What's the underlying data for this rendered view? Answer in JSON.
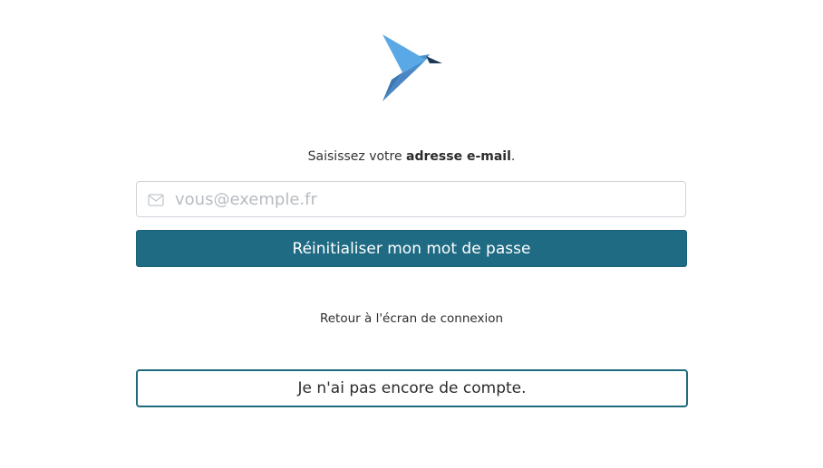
{
  "instruction": {
    "prefix": "Saisissez votre ",
    "emphasis": "adresse e-mail",
    "suffix": "."
  },
  "email": {
    "placeholder": "vous@exemple.fr",
    "value": ""
  },
  "reset_button_label": "Réinitialiser mon mot de passe",
  "back_link_label": "Retour à l'écran de connexion",
  "no_account_button_label": "Je n'ai pas encore de compte.",
  "icons": {
    "logo": "bird-logo-icon",
    "email": "envelope-icon"
  },
  "colors": {
    "primary": "#1f6b84",
    "outline": "#1f6b7d",
    "logo_light": "#5aa9e6",
    "logo_dark": "#1d3a55"
  }
}
